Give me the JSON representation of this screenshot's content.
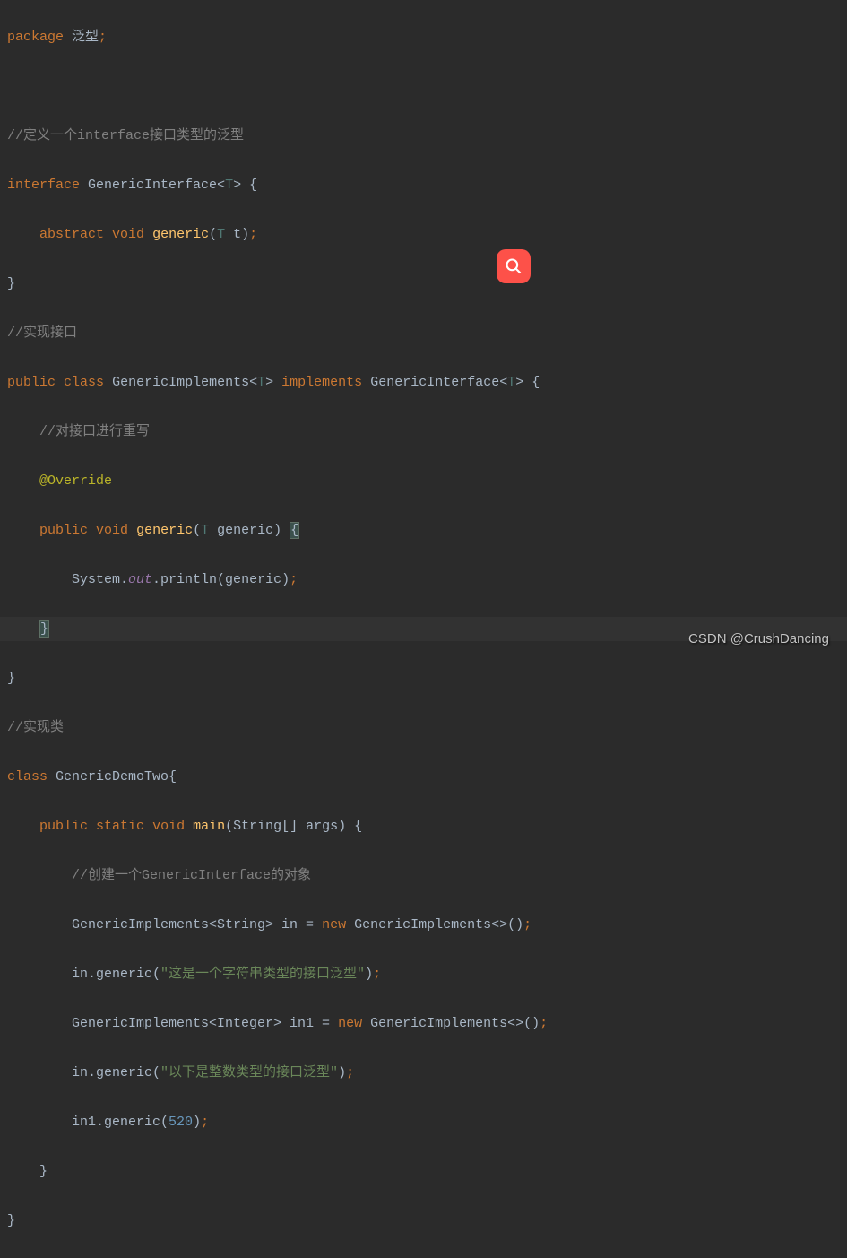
{
  "code": {
    "l1": {
      "package": "package",
      "name": "泛型",
      "semi": ";"
    },
    "l3": {
      "comment": "//定义一个interface接口类型的泛型"
    },
    "l4": {
      "interface": "interface",
      "name": "GenericInterface",
      "lt": "<",
      "T": "T",
      "gt": ">",
      "brace": " {"
    },
    "l5": {
      "abstract": "abstract",
      "void": "void",
      "name": "generic",
      "lparen": "(",
      "T": "T",
      "param": " t)",
      "semi": ";"
    },
    "l6": {
      "brace": "}"
    },
    "l7": {
      "comment": "//实现接口"
    },
    "l8": {
      "public": "public",
      "class": "class",
      "name": "GenericImplements",
      "lt": "<",
      "T": "T",
      "gt": ">",
      "implements": "implements",
      "iname": "GenericInterface",
      "lt2": "<",
      "T2": "T",
      "gt2": ">",
      "brace": " {"
    },
    "l9": {
      "comment": "//对接口进行重写"
    },
    "l10": {
      "annotation": "@Override"
    },
    "l11": {
      "public": "public",
      "void": "void",
      "name": "generic",
      "lparen": "(",
      "T": "T",
      "param": " generic) ",
      "brace": "{"
    },
    "l12": {
      "system": "System.",
      "out": "out",
      "dot": ".println(generic)",
      "semi": ";"
    },
    "l13": {
      "brace": "}"
    },
    "l14": {
      "brace": "}"
    },
    "l15": {
      "comment": "//实现类"
    },
    "l16": {
      "class": "class",
      "name": "GenericDemoTwo{",
      "brace": ""
    },
    "l17": {
      "public": "public",
      "static": "static",
      "void": "void",
      "main": "main",
      "params": "(String[] args) {"
    },
    "l18": {
      "comment": "//创建一个GenericInterface的对象"
    },
    "l19": {
      "type": "GenericImplements<String> in = ",
      "new": "new",
      "ctor": " GenericImplements<>()",
      "semi": ";"
    },
    "l20": {
      "call": "in.generic(",
      "str": "\"这是一个字符串类型的接口泛型\"",
      "end": ")",
      "semi": ";"
    },
    "l21": {
      "type": "GenericImplements<Integer> in1 = ",
      "new": "new",
      "ctor": " GenericImplements<>()",
      "semi": ";"
    },
    "l22": {
      "call": "in.generic(",
      "str": "\"以下是整数类型的接口泛型\"",
      "end": ")",
      "semi": ";"
    },
    "l23": {
      "call": "in1.generic(",
      "num": "520",
      "end": ")",
      "semi": ";"
    },
    "l24": {
      "brace": "}"
    },
    "l25": {
      "brace": "}"
    }
  },
  "watermark": "CSDN @CrushDancing"
}
